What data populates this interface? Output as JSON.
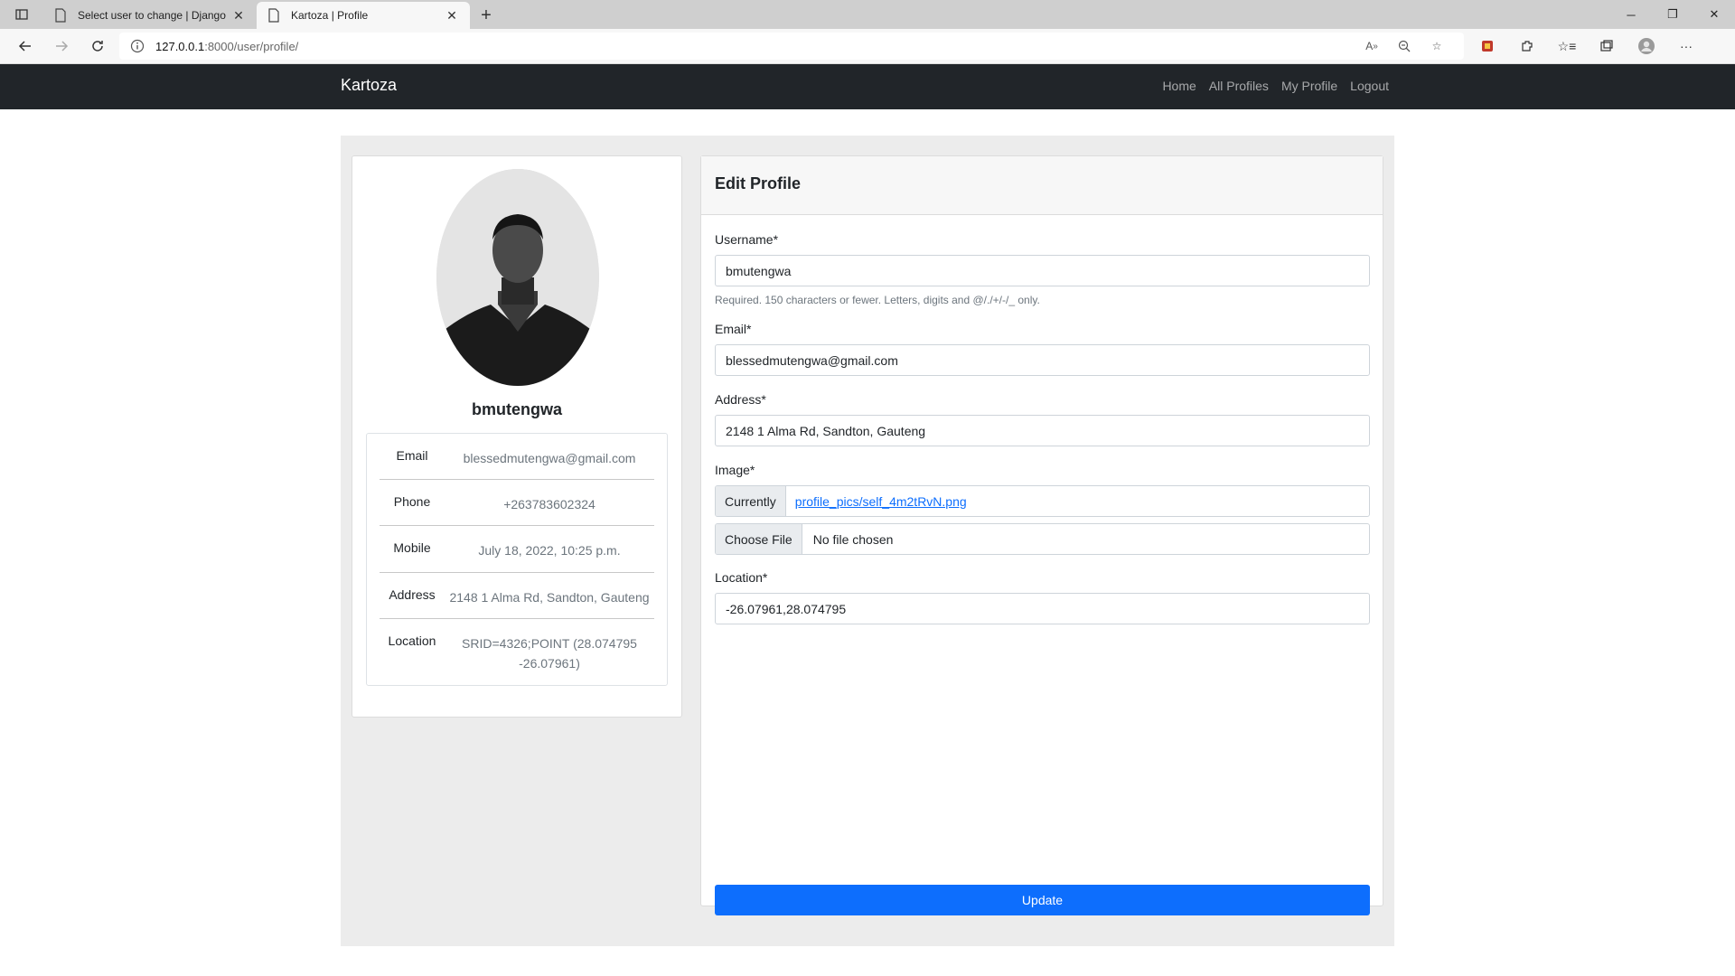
{
  "browser": {
    "tabs": [
      {
        "title": "Select user to change | Django s",
        "active": false
      },
      {
        "title": "Kartoza | Profile",
        "active": true
      }
    ],
    "url_host": "127.0.0.1",
    "url_path": ":8000/user/profile/"
  },
  "navbar": {
    "brand": "Kartoza",
    "links": [
      "Home",
      "All Profiles",
      "My Profile",
      "Logout"
    ]
  },
  "profile": {
    "username": "bmutengwa",
    "rows": [
      {
        "label": "Email",
        "value": "blessedmutengwa@gmail.com"
      },
      {
        "label": "Phone",
        "value": "+263783602324"
      },
      {
        "label": "Mobile",
        "value": "July 18, 2022, 10:25 p.m."
      },
      {
        "label": "Address",
        "value": "2148 1 Alma Rd, Sandton, Gauteng"
      },
      {
        "label": "Location",
        "value": "SRID=4326;POINT (28.074795 -26.07961)"
      }
    ]
  },
  "edit_form": {
    "title": "Edit Profile",
    "username_label": "Username*",
    "username_value": "bmutengwa",
    "username_help": "Required. 150 characters or fewer. Letters, digits and @/./+/-/_ only.",
    "email_label": "Email*",
    "email_value": "blessedmutengwa@gmail.com",
    "address_label": "Address*",
    "address_value": "2148 1 Alma Rd, Sandton, Gauteng",
    "image_label": "Image*",
    "image_currently": "Currently",
    "image_current_file": "profile_pics/self_4m2tRvN.png",
    "choose_file": "Choose File",
    "no_file": "No file chosen",
    "location_label": "Location*",
    "location_value": "-26.07961,28.074795",
    "update_button": "Update"
  },
  "colors": {
    "navbar_bg": "#212529",
    "primary": "#0d6efd"
  }
}
